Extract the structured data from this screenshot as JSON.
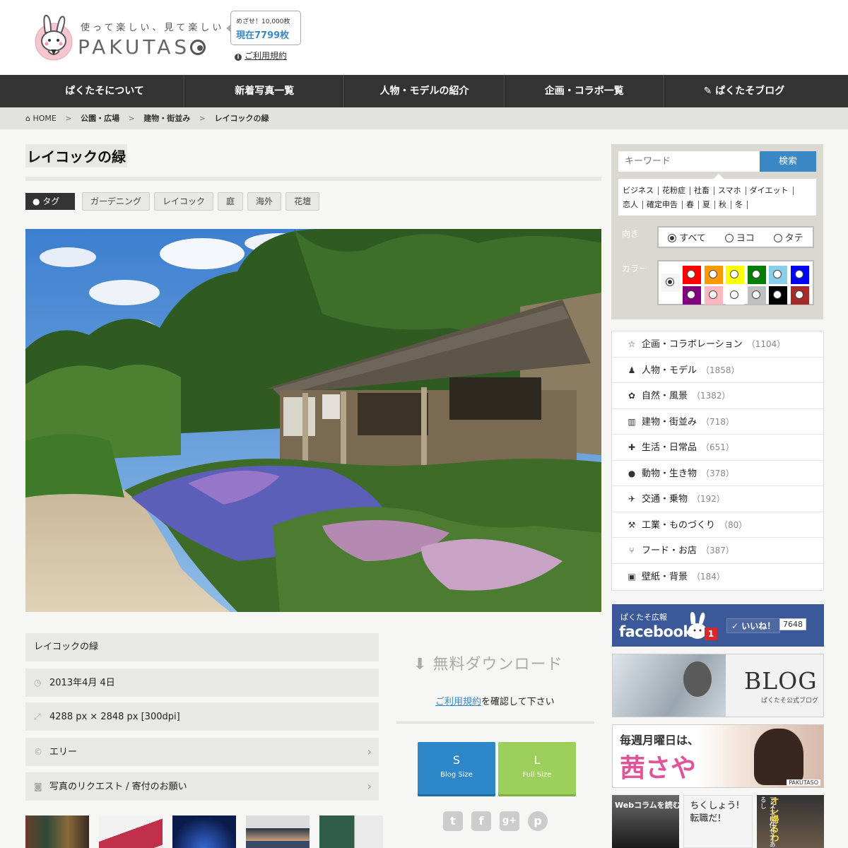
{
  "header": {
    "tagline": "使って楽しい、見て楽しい",
    "brand": "PAKUTAS",
    "goal_label": "めざせ！10,000枚",
    "current_count": "現在7799枚",
    "terms_link": "ご利用規約"
  },
  "nav": {
    "items": [
      {
        "label": "ぱくたそについて"
      },
      {
        "label": "新着写真一覧"
      },
      {
        "label": "人物・モデルの紹介"
      },
      {
        "label": "企画・コラボ一覧"
      },
      {
        "label": "ぱくたそブログ"
      }
    ]
  },
  "breadcrumb": {
    "home": "HOME",
    "sep": ">",
    "level1": "公園・広場",
    "level2": "建物・街並み",
    "current": "レイコックの緑"
  },
  "photo": {
    "title": "レイコックの緑",
    "tag_heading": "タグ",
    "tags": [
      "ガーデニング",
      "レイコック",
      "庭",
      "海外",
      "花壇"
    ]
  },
  "details": {
    "name": "レイコックの緑",
    "date": "2013年4月 4日",
    "size": "4288 px × 2848 px [300dpi]",
    "author": "エリー",
    "request": "写真のリクエスト / 寄付のお願い"
  },
  "download": {
    "title": "無料ダウンロード",
    "note_link": "ご利用規約",
    "note_rest": "を確認して下さい",
    "small_letter": "S",
    "small_label": "Blog Size",
    "large_letter": "L",
    "large_label": "Full Size"
  },
  "sidebar": {
    "search_placeholder": "キーワード",
    "search_button": "検索",
    "keywords": [
      "ビジネス",
      "花粉症",
      "社畜",
      "スマホ",
      "ダイエット",
      "恋人",
      "確定申告",
      "春",
      "夏",
      "秋",
      "冬"
    ],
    "orientation_label": "向き",
    "orientation_options": [
      "すべて",
      "ヨコ",
      "タテ"
    ],
    "color_label": "カラー",
    "colors": [
      "#ff0000",
      "#ff9900",
      "#ffff00",
      "#008000",
      "#87ceeb",
      "#0000ff",
      "#800080",
      "#ffb6c1",
      "#ffffff",
      "#c0c0c0",
      "#000000",
      "#a52a2a"
    ],
    "categories": [
      {
        "icon": "star-icon",
        "glyph": "☆",
        "label": "企画・コラボレーション",
        "count": "（1104）"
      },
      {
        "icon": "person-icon",
        "glyph": "♟",
        "label": "人物・モデル",
        "count": "（1858）"
      },
      {
        "icon": "leaf-icon",
        "glyph": "✿",
        "label": "自然・風景",
        "count": "（1382）"
      },
      {
        "icon": "building-icon",
        "glyph": "▥",
        "label": "建物・街並み",
        "count": "（718）"
      },
      {
        "icon": "puzzle-icon",
        "glyph": "✚",
        "label": "生活・日常品",
        "count": "（651）"
      },
      {
        "icon": "globe-icon",
        "glyph": "●",
        "label": "動物・生き物",
        "count": "（378）"
      },
      {
        "icon": "plane-icon",
        "glyph": "✈",
        "label": "交通・乗物",
        "count": "（192）"
      },
      {
        "icon": "wrench-icon",
        "glyph": "⚒",
        "label": "工業・ものづくり",
        "count": "（80）"
      },
      {
        "icon": "fork-knife-icon",
        "glyph": "⑂",
        "label": "フード・お店",
        "count": "（387）"
      },
      {
        "icon": "picture-icon",
        "glyph": "▣",
        "label": "壁紙・背景",
        "count": "（184）"
      }
    ],
    "fb_top": "ぱくたそ広報",
    "fb_word": "facebook",
    "fb_badge": "1",
    "fb_like": "✓ いいね！",
    "fb_count": "7648",
    "blog_title": "BLOG",
    "blog_sub": "ぱくたそ公式ブログ",
    "akane_top": "毎週月曜日は、",
    "akane_name": "茜さや",
    "akane_logo": "PAKUTASO",
    "web_column": "Webコラムを読む",
    "tenshoku": "ちくしょう!\n転職だ!",
    "orekaeru_1": "オレ帰るわ",
    "orekaeru_2": "アスエに任せてあるし"
  },
  "colors": {
    "accent": "#3a88c5",
    "nav_bg": "#333333",
    "green_button": "#9ccf5b"
  }
}
